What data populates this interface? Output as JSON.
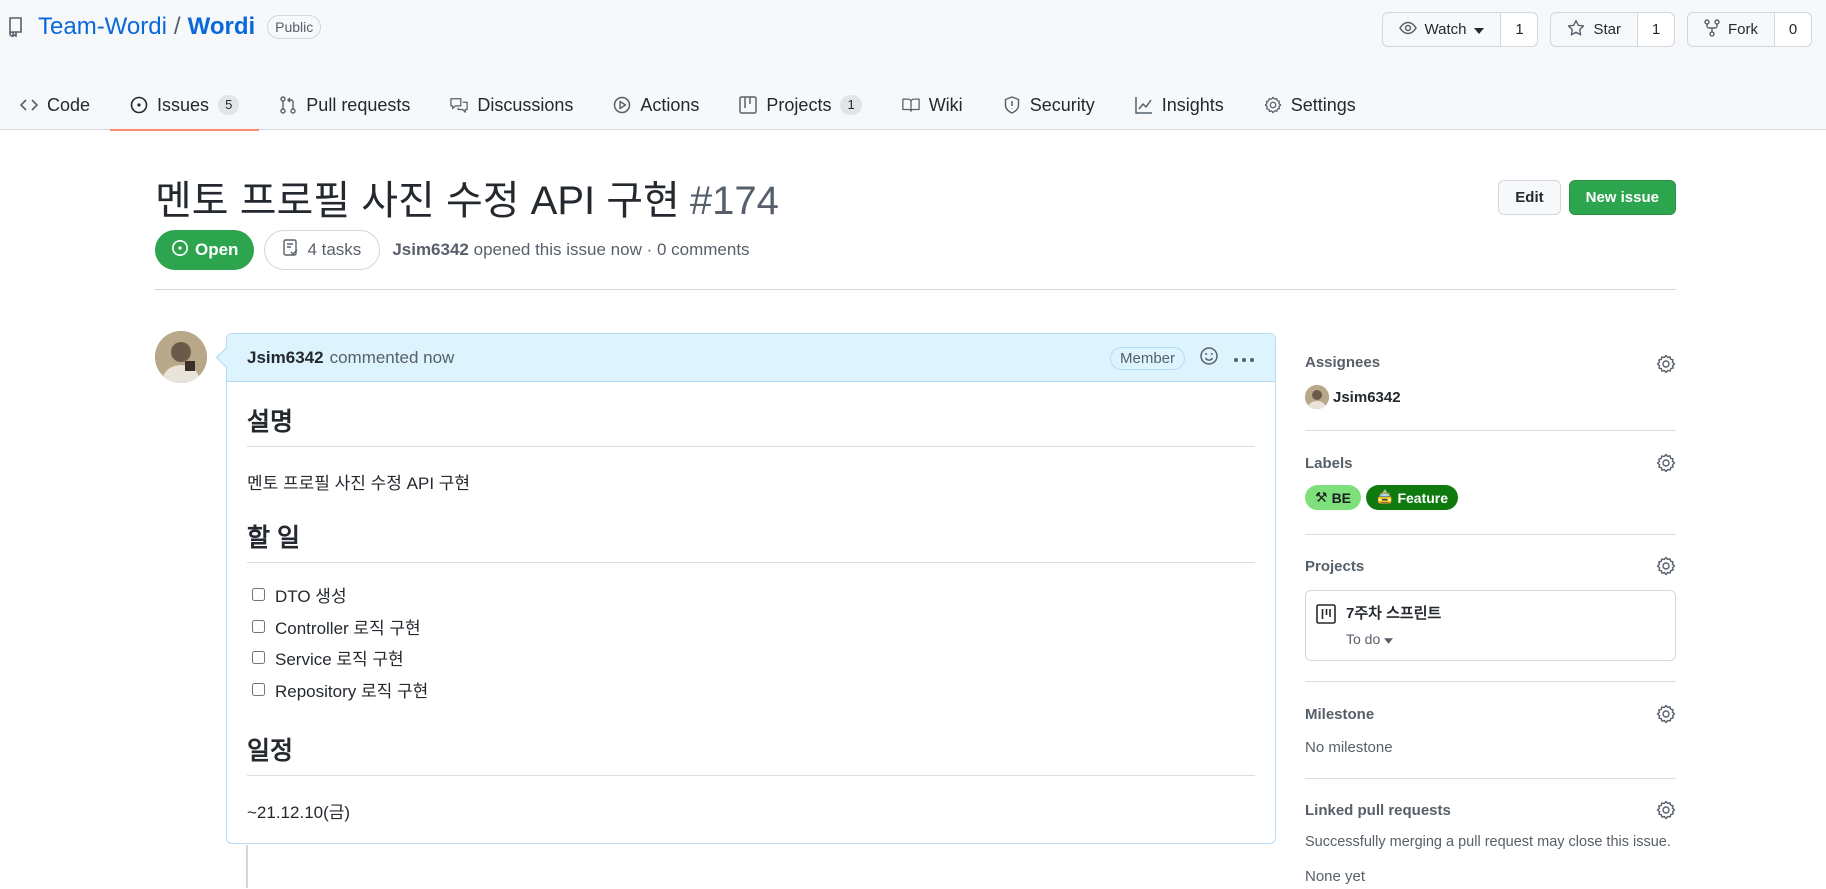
{
  "repo": {
    "owner": "Team-Wordi",
    "separator": "/",
    "name": "Wordi",
    "visibility": "Public",
    "actions": [
      {
        "icon": "eye-icon",
        "label": "Watch",
        "count": "1"
      },
      {
        "icon": "star-icon",
        "label": "Star",
        "count": "1"
      },
      {
        "icon": "fork-icon",
        "label": "Fork",
        "count": "0"
      }
    ],
    "nav": [
      {
        "icon": "code-icon",
        "label": "Code",
        "counter": ""
      },
      {
        "icon": "issue-opened-icon",
        "label": "Issues",
        "counter": "5"
      },
      {
        "icon": "git-pull-request-icon",
        "label": "Pull requests",
        "counter": ""
      },
      {
        "icon": "comment-discussion-icon",
        "label": "Discussions",
        "counter": ""
      },
      {
        "icon": "play-icon",
        "label": "Actions",
        "counter": ""
      },
      {
        "icon": "table-icon",
        "label": "Projects",
        "counter": "1"
      },
      {
        "icon": "book-icon",
        "label": "Wiki",
        "counter": ""
      },
      {
        "icon": "shield-icon",
        "label": "Security",
        "counter": ""
      },
      {
        "icon": "graph-icon",
        "label": "Insights",
        "counter": ""
      },
      {
        "icon": "gear-icon",
        "label": "Settings",
        "counter": ""
      }
    ]
  },
  "issue": {
    "title": "멘토 프로필 사진 수정 API 구현",
    "number": "#174",
    "edit_label": "Edit",
    "new_issue_label": "New issue",
    "state": "Open",
    "tasks": "4 tasks",
    "author": "Jsim6342",
    "meta": "opened this issue now · 0 comments"
  },
  "comment": {
    "author": "Jsim6342",
    "time": "commented now",
    "badge": "Member",
    "h_desc": "설명",
    "desc": "멘토 프로필 사진 수정 API 구현",
    "h_todo": "할 일",
    "todos": [
      "DTO 생성",
      "Controller 로직 구현",
      "Service 로직 구현",
      "Repository 로직 구현"
    ],
    "h_schedule": "일정",
    "schedule": "~21.12.10(금)"
  },
  "sidebar": {
    "assignees": {
      "heading": "Assignees",
      "user": "Jsim6342"
    },
    "labels": {
      "heading": "Labels",
      "items": [
        {
          "emoji": "⚒",
          "name": "BE",
          "bg": "#7ee07a",
          "fg": "#1b1f23"
        },
        {
          "emoji": "🚖",
          "name": "Feature",
          "bg": "#0f7b0f",
          "fg": "#ffffff"
        }
      ]
    },
    "projects": {
      "heading": "Projects",
      "name": "7주차 스프린트",
      "status": "To do"
    },
    "milestone": {
      "heading": "Milestone",
      "value": "No milestone"
    },
    "linked_prs": {
      "heading": "Linked pull requests",
      "note": "Successfully merging a pull request may close this issue.",
      "value": "None yet"
    }
  },
  "colors": {
    "accent": "#0969da",
    "open_green": "#2da44e",
    "nav_underline": "#fd8c73"
  }
}
